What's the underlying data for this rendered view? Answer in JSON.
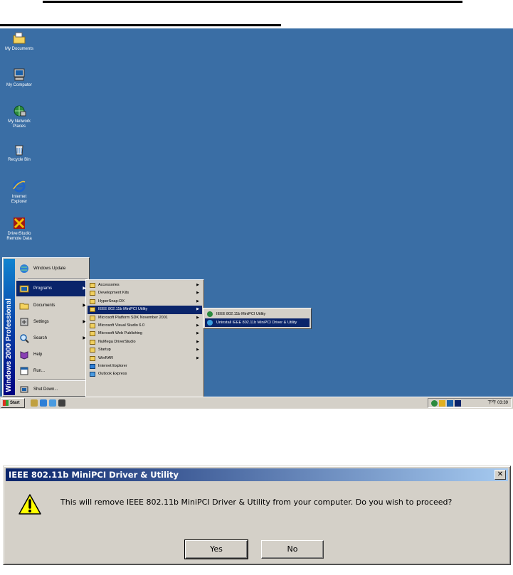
{
  "desktop": {
    "icons": [
      {
        "label_lines": [
          "My Documents"
        ],
        "icon": "folder-icon"
      },
      {
        "label_lines": [
          "My Computer"
        ],
        "icon": "computer-icon"
      },
      {
        "label_lines": [
          "My Network",
          "Places"
        ],
        "icon": "network-icon"
      },
      {
        "label_lines": [
          "Recycle Bin"
        ],
        "icon": "recycle-bin-icon"
      },
      {
        "label_lines": [
          "Internet",
          "Explorer"
        ],
        "icon": "internet-explorer-icon"
      },
      {
        "label_lines": [
          "DriverStudio",
          "Remote Data"
        ],
        "icon": "driverstudio-icon"
      }
    ],
    "background_color": "#3a6ea5"
  },
  "start_menu": {
    "banner_text": "Windows 2000 Professional",
    "items": [
      {
        "label": "Windows Update"
      },
      {
        "label": "Programs",
        "has_submenu": true,
        "highlighted": true
      },
      {
        "label": "Documents",
        "has_submenu": true
      },
      {
        "label": "Settings",
        "has_submenu": true
      },
      {
        "label": "Search",
        "has_submenu": true
      },
      {
        "label": "Help"
      },
      {
        "label": "Run..."
      },
      {
        "label": "Shut Down..."
      }
    ]
  },
  "programs_menu": {
    "items": [
      {
        "label": "Accessories",
        "has_submenu": true
      },
      {
        "label": "Development Kits",
        "has_submenu": true
      },
      {
        "label": "HyperSnap-DX",
        "has_submenu": true
      },
      {
        "label": "IEEE 802.11b MiniPCI Utility",
        "has_submenu": true,
        "highlighted": true
      },
      {
        "label": "Microsoft Platform SDK November 2001",
        "has_submenu": true
      },
      {
        "label": "Microsoft Visual Studio 6.0",
        "has_submenu": true
      },
      {
        "label": "Microsoft Web Publishing",
        "has_submenu": true
      },
      {
        "label": "NuMega DriverStudio",
        "has_submenu": true
      },
      {
        "label": "Startup",
        "has_submenu": true
      },
      {
        "label": "WinRAR",
        "has_submenu": true
      },
      {
        "label": "Internet Explorer",
        "has_submenu": false
      },
      {
        "label": "Outlook Express",
        "has_submenu": false
      }
    ]
  },
  "ieee_menu": {
    "items": [
      {
        "label": "IEEE 802.11b MiniPCI Utility"
      },
      {
        "label": "Uninstall IEEE 802.11b MiniPCI Driver & Utility",
        "highlighted": true
      }
    ]
  },
  "taskbar": {
    "start_label": "Start",
    "clock": "下午 03:39"
  },
  "dialog": {
    "title": "IEEE 802.11b MiniPCI Driver & Utility",
    "close_glyph": "✕",
    "message": "This will remove IEEE 802.11b MiniPCI Driver & Utility from your computer. Do you wish to proceed?",
    "yes_label": "Yes",
    "no_label": "No"
  },
  "colors": {
    "title_bar_start": "#0a246a",
    "title_bar_end": "#a6caf0",
    "menu_highlight": "#0a246a",
    "window_face": "#d4d0c8"
  }
}
